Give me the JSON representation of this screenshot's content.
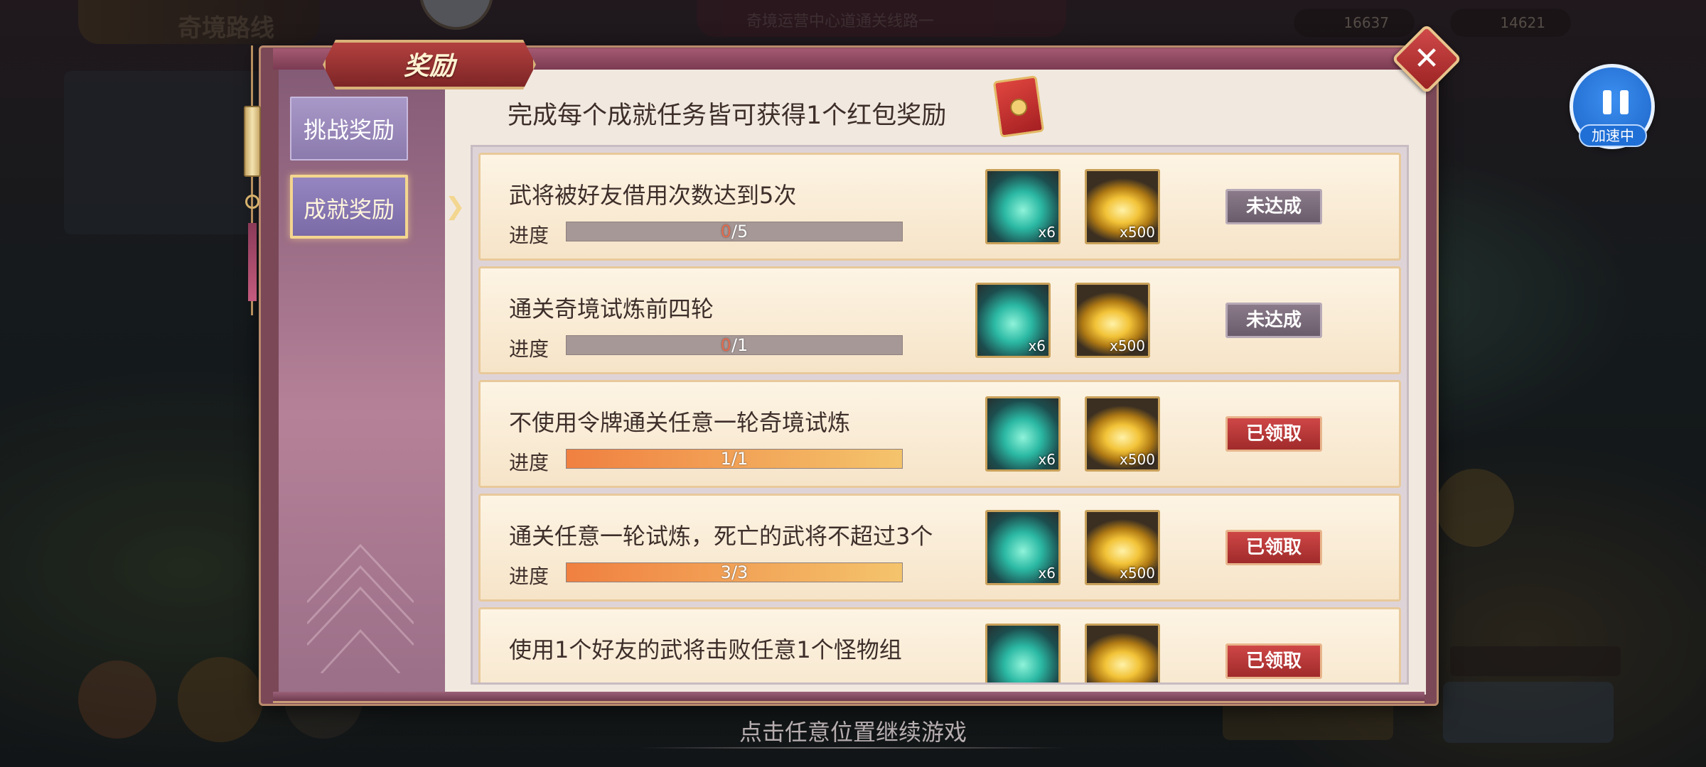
{
  "background": {
    "top_left_title": "奇境路线",
    "banner_text": "奇境运营中心道通关线路一",
    "currency": [
      {
        "icon": "gold-ingot-icon",
        "value": "16637"
      },
      {
        "icon": "blue-gem-icon",
        "value": "14621"
      }
    ]
  },
  "speed_badge": {
    "label": "加速中",
    "icon": "pause-icon"
  },
  "modal": {
    "title": "奖励",
    "close_icon": "close-icon",
    "tabs": [
      {
        "label": "挑战奖励",
        "selected": false
      },
      {
        "label": "成就奖励",
        "selected": true
      }
    ],
    "header": "完成每个成就任务皆可获得1个红包奖励",
    "header_icon": "red-packet-icon",
    "progress_label": "进度",
    "tasks": [
      {
        "title": "武将被好友借用次数达到5次",
        "progress_current": "0",
        "progress_total": "/5",
        "progress_fraction": 0.0,
        "rewards": [
          {
            "icon": "spirit-flame-icon",
            "qty": "x6"
          },
          {
            "icon": "gold-ingot-icon",
            "qty": "x500"
          }
        ],
        "status": "未达成",
        "status_type": "pending"
      },
      {
        "title": "通关奇境试炼前四轮",
        "progress_current": "0",
        "progress_total": "/1",
        "progress_fraction": 0.0,
        "rewards": [
          {
            "icon": "spirit-flame-icon",
            "qty": "x6"
          },
          {
            "icon": "gold-ingot-icon",
            "qty": "x500"
          }
        ],
        "status": "未达成",
        "status_type": "pending"
      },
      {
        "title": "不使用令牌通关任意一轮奇境试炼",
        "progress_current": "1",
        "progress_total": "/1",
        "progress_fraction": 1.0,
        "rewards": [
          {
            "icon": "spirit-flame-icon",
            "qty": "x6"
          },
          {
            "icon": "gold-ingot-icon",
            "qty": "x500"
          }
        ],
        "status": "已领取",
        "status_type": "claimed"
      },
      {
        "title": "通关任意一轮试炼，死亡的武将不超过3个",
        "progress_current": "3",
        "progress_total": "/3",
        "progress_fraction": 1.0,
        "rewards": [
          {
            "icon": "spirit-flame-icon",
            "qty": "x6"
          },
          {
            "icon": "gold-ingot-icon",
            "qty": "x500"
          }
        ],
        "status": "已领取",
        "status_type": "claimed"
      },
      {
        "title": "使用1个好友的武将击败任意1个怪物组",
        "rewards": [
          {
            "icon": "spirit-flame-icon",
            "qty": ""
          },
          {
            "icon": "gold-ingot-icon",
            "qty": ""
          }
        ],
        "status": "已领取",
        "status_type": "claimed"
      }
    ]
  },
  "continue_hint": "点击任意位置继续游戏",
  "colors": {
    "accent_gold": "#f3d68f",
    "claimed_red": "#c23a3a",
    "pending_gray": "#7d6e7c",
    "progress_orange": "#f08040"
  }
}
